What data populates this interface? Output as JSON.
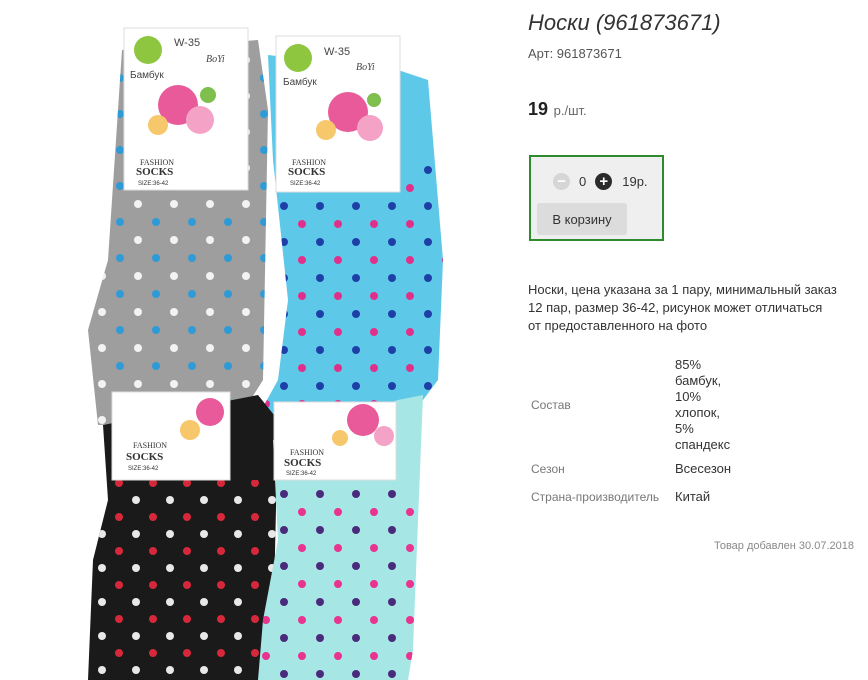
{
  "product": {
    "title": "Носки (961873671)",
    "sku": "Арт: 961873671",
    "price": "19",
    "price_unit": "р./шт.",
    "quantity": "0",
    "total": "19р.",
    "minus_symbol": "−",
    "plus_symbol": "+",
    "add_to_cart": "В корзину",
    "description": "Носки, цена указана за 1 пару, минимальный заказ 12 пар, размер 36-42, рисунок может отличаться от предоставленного на фото",
    "attributes": [
      {
        "label": "Состав",
        "value_lines": [
          "85%",
          "бамбук,",
          "10%",
          "хлопок,",
          "5%",
          "спандекс"
        ]
      },
      {
        "label": "Сезон",
        "value": "Всесезон"
      },
      {
        "label": "Страна-производитель",
        "value": "Китай"
      }
    ],
    "added": "Товар добавлен 30.07.2018"
  },
  "photo": {
    "tag_code": "W-35",
    "tag_brand": "BoYi",
    "tag_material": "Бамбук",
    "tag_line1": "FASHION",
    "tag_line2": "SOCKS",
    "tag_size": "SIZE:36-42"
  },
  "colors": {
    "buybox_border": "#2e8b2e",
    "sock_grey": "#9e9e9e",
    "sock_cyan": "#5ec8e8",
    "sock_black": "#1a1a1a",
    "sock_mint": "#a6e6e4"
  },
  "icons": {
    "minus": "minus-circle-icon",
    "plus": "plus-circle-icon"
  }
}
